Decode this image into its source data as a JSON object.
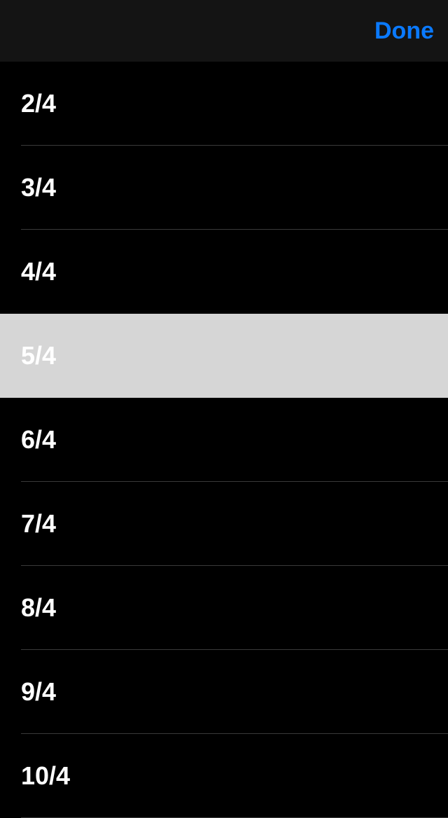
{
  "header": {
    "done_label": "Done"
  },
  "list": {
    "items": [
      {
        "label": "2/4",
        "selected": false
      },
      {
        "label": "3/4",
        "selected": false
      },
      {
        "label": "4/4",
        "selected": false
      },
      {
        "label": "5/4",
        "selected": true
      },
      {
        "label": "6/4",
        "selected": false
      },
      {
        "label": "7/4",
        "selected": false
      },
      {
        "label": "8/4",
        "selected": false
      },
      {
        "label": "9/4",
        "selected": false
      },
      {
        "label": "10/4",
        "selected": false
      }
    ]
  }
}
